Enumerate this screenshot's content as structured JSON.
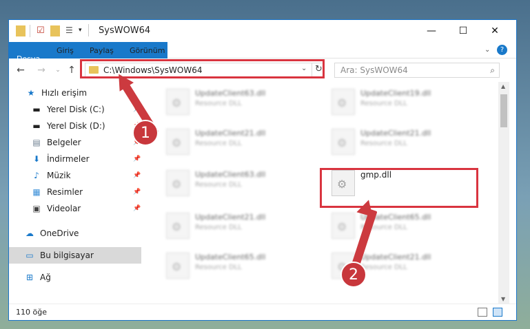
{
  "window": {
    "title": "SysWOW64"
  },
  "ribbon": {
    "tabs": [
      "Dosya",
      "Giriş",
      "Paylaş",
      "Görünüm"
    ]
  },
  "address": {
    "path": "C:\\Windows\\SysWOW64",
    "search_placeholder": "Ara: SysWOW64"
  },
  "sidebar": {
    "quick_access": "Hızlı erişim",
    "items": [
      "Yerel Disk (C:)",
      "Yerel Disk (D:)",
      "Belgeler",
      "İndirmeler",
      "Müzik",
      "Resimler",
      "Videolar"
    ],
    "onedrive": "OneDrive",
    "this_pc": "Bu bilgisayar",
    "network": "Ağ"
  },
  "files": [
    {
      "name": "UpdateClient63.dll",
      "type": "Resource DLL"
    },
    {
      "name": "UpdateClient19.dll",
      "type": "Resource DLL"
    },
    {
      "name": "UpdateClient21.dll",
      "type": "Resource DLL"
    },
    {
      "name": "UpdateClient21.dll",
      "type": "Resource DLL"
    },
    {
      "name": "UpdateClient63.dll",
      "type": "Resource DLL"
    },
    {
      "name": "gmp.dll",
      "type": ""
    },
    {
      "name": "UpdateClient21.dll",
      "type": "Resource DLL"
    },
    {
      "name": "UpdateClient65.dll",
      "type": "Resource DLL"
    },
    {
      "name": "UpdateClient65.dll",
      "type": "Resource DLL"
    },
    {
      "name": "UpdateClient21.dll",
      "type": "Resource DLL"
    }
  ],
  "status": {
    "count": "110 öğe"
  },
  "annotations": [
    "1",
    "2"
  ],
  "colors": {
    "accent": "#1979ca",
    "highlight": "#d9343f"
  }
}
